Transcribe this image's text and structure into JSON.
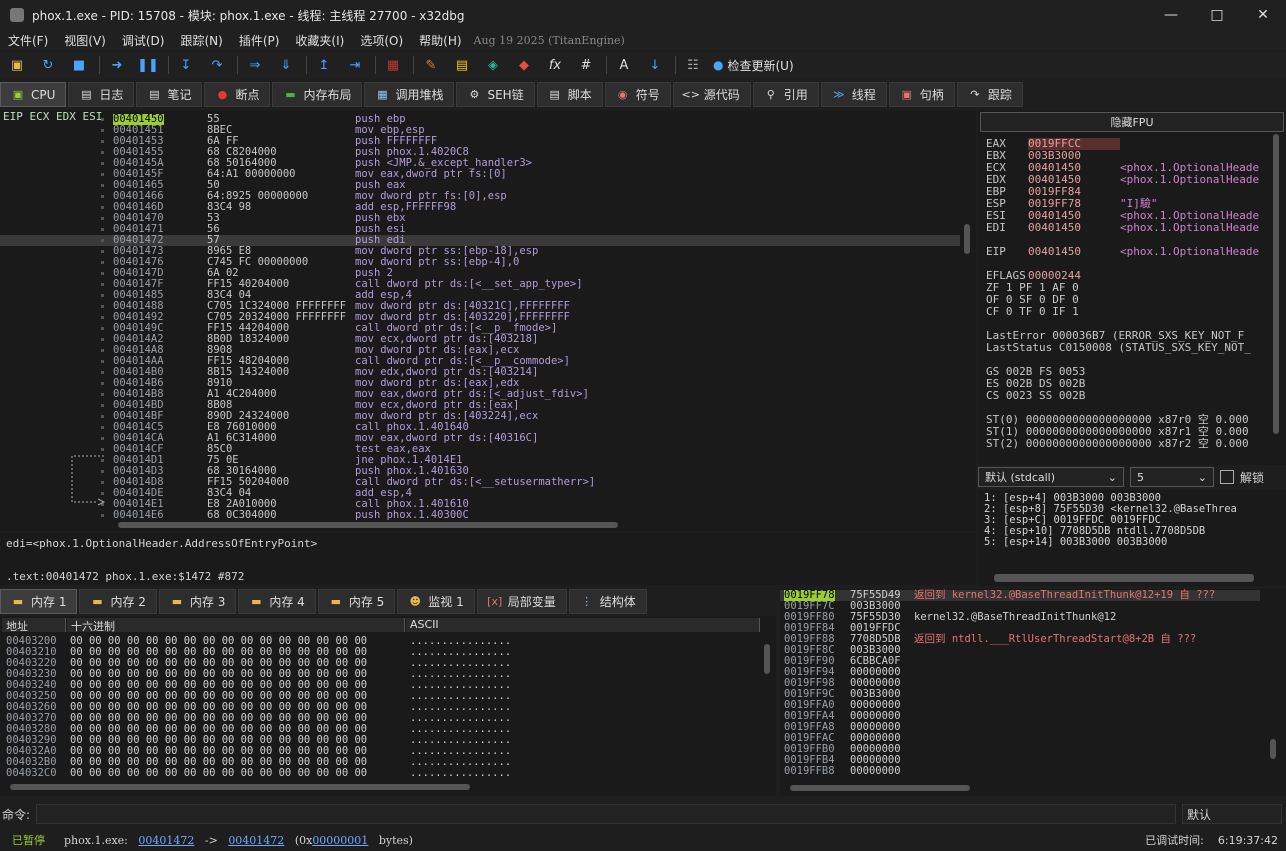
{
  "window": {
    "title": "phox.1.exe - PID: 15708 - 模块: phox.1.exe - 线程: 主线程 27700 - x32dbg"
  },
  "menu": {
    "items": [
      "文件(F)",
      "视图(V)",
      "调试(D)",
      "跟踪(N)",
      "插件(P)",
      "收藏夹(I)",
      "选项(O)",
      "帮助(H)"
    ],
    "build": "Aug 19 2025 (TitanEngine)"
  },
  "toolbar": {
    "update_label": "检查更新(U)"
  },
  "tabs": [
    "CPU",
    "日志",
    "笔记",
    "断点",
    "内存布局",
    "调用堆栈",
    "SEH链",
    "脚本",
    "符号",
    "源代码",
    "引用",
    "线程",
    "句柄",
    "跟踪"
  ],
  "cpu": {
    "reg_labels": "EIP ECX EDX ESI",
    "rows": [
      [
        "00401450",
        "55",
        "push ebp"
      ],
      [
        "00401451",
        "8BEC",
        "mov ebp,esp"
      ],
      [
        "00401453",
        "6A FF",
        "push FFFFFFFF"
      ],
      [
        "00401455",
        "68 C8204000",
        "push phox.1.4020C8"
      ],
      [
        "0040145A",
        "68 50164000",
        "push <JMP.&_except_handler3>"
      ],
      [
        "0040145F",
        "64:A1 00000000",
        "mov eax,dword ptr fs:[0]"
      ],
      [
        "00401465",
        "50",
        "push eax"
      ],
      [
        "00401466",
        "64:8925 00000000",
        "mov dword ptr fs:[0],esp"
      ],
      [
        "0040146D",
        "83C4 98",
        "add esp,FFFFFF98"
      ],
      [
        "00401470",
        "53",
        "push ebx"
      ],
      [
        "00401471",
        "56",
        "push esi"
      ],
      [
        "00401472",
        "57",
        "push edi"
      ],
      [
        "00401473",
        "8965 E8",
        "mov dword ptr ss:[ebp-18],esp"
      ],
      [
        "00401476",
        "C745 FC 00000000",
        "mov dword ptr ss:[ebp-4],0"
      ],
      [
        "0040147D",
        "6A 02",
        "push 2"
      ],
      [
        "0040147F",
        "FF15 40204000",
        "call dword ptr ds:[<__set_app_type>]"
      ],
      [
        "00401485",
        "83C4 04",
        "add esp,4"
      ],
      [
        "00401488",
        "C705 1C324000 FFFFFFFF",
        "mov dword ptr ds:[40321C],FFFFFFFF"
      ],
      [
        "00401492",
        "C705 20324000 FFFFFFFF",
        "mov dword ptr ds:[403220],FFFFFFFF"
      ],
      [
        "0040149C",
        "FF15 44204000",
        "call dword ptr ds:[<__p__fmode>]"
      ],
      [
        "004014A2",
        "8B0D 18324000",
        "mov ecx,dword ptr ds:[403218]"
      ],
      [
        "004014A8",
        "8908",
        "mov dword ptr ds:[eax],ecx"
      ],
      [
        "004014AA",
        "FF15 48204000",
        "call dword ptr ds:[<__p__commode>]"
      ],
      [
        "004014B0",
        "8B15 14324000",
        "mov edx,dword ptr ds:[403214]"
      ],
      [
        "004014B6",
        "8910",
        "mov dword ptr ds:[eax],edx"
      ],
      [
        "004014B8",
        "A1 4C204000",
        "mov eax,dword ptr ds:[<_adjust_fdiv>]"
      ],
      [
        "004014BD",
        "8B08",
        "mov ecx,dword ptr ds:[eax]"
      ],
      [
        "004014BF",
        "890D 24324000",
        "mov dword ptr ds:[403224],ecx"
      ],
      [
        "004014C5",
        "E8 76010000",
        "call phox.1.401640"
      ],
      [
        "004014CA",
        "A1 6C314000",
        "mov eax,dword ptr ds:[40316C]"
      ],
      [
        "004014CF",
        "85C0",
        "test eax,eax"
      ],
      [
        "004014D1",
        "75 0E",
        "jne phox.1.4014E1"
      ],
      [
        "004014D3",
        "68 30164000",
        "push phox.1.401630"
      ],
      [
        "004014D8",
        "FF15 50204000",
        "call dword ptr ds:[<__setusermatherr>]"
      ],
      [
        "004014DE",
        "83C4 04",
        "add esp,4"
      ],
      [
        "004014E1",
        "E8 2A010000",
        "call phox.1.401610"
      ],
      [
        "004014E6",
        "68 0C304000",
        "push phox.1.40300C"
      ]
    ]
  },
  "info": {
    "line1": "edi=<phox.1.OptionalHeader.AddressOfEntryPoint>",
    "line2": ".text:00401472 phox.1.exe:$1472 #872"
  },
  "registers": {
    "fpu_button": "隐藏FPU",
    "lines": [
      [
        "EAX",
        "0019FFCC",
        ""
      ],
      [
        "EBX",
        "003B3000",
        ""
      ],
      [
        "ECX",
        "00401450",
        "<phox.1.OptionalHeade"
      ],
      [
        "EDX",
        "00401450",
        "<phox.1.OptionalHeade"
      ],
      [
        "EBP",
        "0019FF84",
        ""
      ],
      [
        "ESP",
        "0019FF78",
        "\"I]驗\""
      ],
      [
        "ESI",
        "00401450",
        "<phox.1.OptionalHeade"
      ],
      [
        "EDI",
        "00401450",
        "<phox.1.OptionalHeade"
      ],
      [
        "",
        "",
        " "
      ],
      [
        "EIP",
        "00401450",
        "<phox.1.OptionalHeade"
      ],
      [
        "",
        "",
        " "
      ],
      [
        "EFLAGS",
        "00000244",
        ""
      ],
      [
        "ZF 1  PF 1  AF 0",
        "",
        ""
      ],
      [
        "OF 0  SF 0  DF 0",
        "",
        ""
      ],
      [
        "CF 0  TF 0  IF 1",
        "",
        ""
      ],
      [
        "",
        "",
        " "
      ],
      [
        "LastError  000036B7 (ERROR_SXS_KEY_NOT_F",
        "",
        ""
      ],
      [
        "LastStatus C0150008 (STATUS_SXS_KEY_NOT_",
        "",
        ""
      ],
      [
        "",
        "",
        " "
      ],
      [
        "GS 002B  FS 0053",
        "",
        ""
      ],
      [
        "ES 002B  DS 002B",
        "",
        ""
      ],
      [
        "CS 0023  SS 002B",
        "",
        ""
      ],
      [
        "",
        "",
        " "
      ],
      [
        "ST(0) 0000000000000000000 x87r0 空 0.000",
        "",
        ""
      ],
      [
        "ST(1) 0000000000000000000 x87r1 空 0.000",
        "",
        ""
      ],
      [
        "ST(2) 0000000000000000000 x87r2 空 0.000",
        "",
        ""
      ]
    ],
    "call_conv": "默认 (stdcall)",
    "arg_count": "5",
    "unlock_label": "解锁",
    "args": [
      "1: [esp+4] 003B3000 003B3000",
      "2: [esp+8] 75F55D30 <kernel32.@BaseThrea",
      "3: [esp+C] 0019FFDC 0019FFDC",
      "4: [esp+10] 7708D5DB ntdll.7708D5DB",
      "5: [esp+14] 003B3000 003B3000"
    ]
  },
  "dump": {
    "tabs": [
      "内存 1",
      "内存 2",
      "内存 3",
      "内存 4",
      "内存 5",
      "监视 1",
      "局部变量",
      "结构体"
    ],
    "headers": [
      "地址",
      "十六进制",
      "ASCII"
    ],
    "rows": [
      "00403200",
      "00403210",
      "00403220",
      "00403230",
      "00403240",
      "00403250",
      "00403260",
      "00403270",
      "00403280",
      "00403290",
      "004032A0",
      "004032B0",
      "004032C0"
    ],
    "hex": "00 00 00 00 00 00 00 00 00 00 00 00 00 00 00 00",
    "ascii": "................"
  },
  "stack": {
    "rows": [
      [
        "0019FF78",
        "75F55D49",
        "返回到 kernel32.@BaseThreadInitThunk@12+19 自 ???"
      ],
      [
        "0019FF7C",
        "003B3000",
        ""
      ],
      [
        "0019FF80",
        "75F55D30",
        "kernel32.@BaseThreadInitThunk@12"
      ],
      [
        "0019FF84",
        "0019FFDC",
        ""
      ],
      [
        "0019FF88",
        "7708D5DB",
        "返回到 ntdll.___RtlUserThreadStart@8+2B 自 ???"
      ],
      [
        "0019FF8C",
        "003B3000",
        ""
      ],
      [
        "0019FF90",
        "6CBBCA0F",
        ""
      ],
      [
        "0019FF94",
        "00000000",
        ""
      ],
      [
        "0019FF98",
        "00000000",
        ""
      ],
      [
        "0019FF9C",
        "003B3000",
        ""
      ],
      [
        "0019FFA0",
        "00000000",
        ""
      ],
      [
        "0019FFA4",
        "00000000",
        ""
      ],
      [
        "0019FFA8",
        "00000000",
        ""
      ],
      [
        "0019FFAC",
        "00000000",
        ""
      ],
      [
        "0019FFB0",
        "00000000",
        ""
      ],
      [
        "0019FFB4",
        "00000000",
        ""
      ],
      [
        "0019FFB8",
        "00000000",
        ""
      ]
    ]
  },
  "command": {
    "label": "命令:",
    "default": "默认"
  },
  "status": {
    "state": "已暂停",
    "msg_prefix": "phox.1.exe:",
    "from": "00401472",
    "arrow": "->",
    "to": "00401472",
    "size_open": "(0x",
    "size": "00000001",
    "size_close": "bytes)",
    "time_label": "已调试时间:",
    "time": "6:19:37:42"
  }
}
